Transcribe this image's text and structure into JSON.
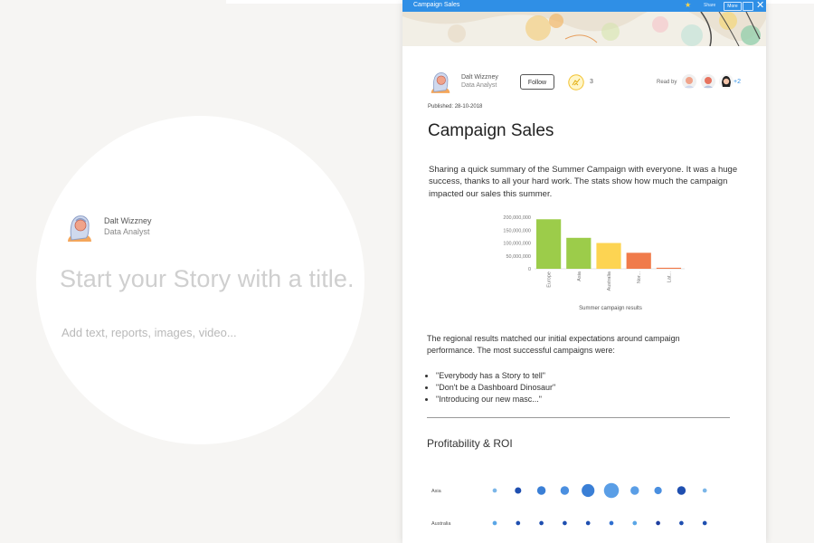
{
  "editor": {
    "author_name": "Dalt Wizzney",
    "author_role": "Data Analyst",
    "title_placeholder": "Start your Story with a title.",
    "body_placeholder": "Add text, reports, images, video..."
  },
  "story": {
    "window_title": "Campaign Sales",
    "toolbar": {
      "share_label": "Share",
      "more_label": "More"
    },
    "author_name": "Dalt Wizzney",
    "author_role": "Data Analyst",
    "follow_label": "Follow",
    "like_count": "3",
    "read_by_label": "Read by",
    "read_by_more": "+2",
    "published_label": "Published:",
    "published_date": "28-10-2018",
    "title": "Campaign Sales",
    "intro": "Sharing a quick summary of the Summer Campaign with everyone. It was a huge success, thanks to all your hard work. The stats show how much the campaign impacted our sales this summer.",
    "paragraph2": "The regional results matched our initial expectations around campaign performance. The most successful campaigns were:",
    "campaigns": [
      "\"Everybody has a Story to tell\"",
      "\"Don't be a Dashboard Dinosaur\"",
      "\"Introducing our new masc...\""
    ],
    "section_title": "Profitability & ROI"
  },
  "colors": {
    "titlebar": "#2f8fe6",
    "bar_europe": "#9ccc4a",
    "bar_asia": "#9ccc4a",
    "bar_australia": "#fdd452",
    "bar_north": "#f07b4b",
    "bar_latin": "#f07b4b",
    "bubble": "#2f7fdc"
  },
  "chart_data": [
    {
      "type": "bar",
      "title": "",
      "xlabel": "Summer campaign results",
      "ylabel": "",
      "categories": [
        "Europe",
        "Asia",
        "Australia",
        "Nor...",
        "Lat..."
      ],
      "values": [
        192000000,
        120000000,
        100000000,
        62000000,
        4000000
      ],
      "ylim": [
        0,
        200000000
      ],
      "yticks": [
        "0",
        "50,000,000",
        "100,000,000",
        "150,000,000",
        "200,000,000"
      ],
      "ytick_values": [
        0,
        50000000,
        100000000,
        150000000,
        200000000
      ],
      "grid": false
    },
    {
      "type": "scatter",
      "title": "Profitability & ROI",
      "rows": [
        {
          "name": "Asia",
          "sizes": [
            2,
            3,
            4,
            4,
            6,
            7,
            4,
            3.5,
            4,
            2
          ]
        },
        {
          "name": "Australia",
          "sizes": [
            2,
            2,
            2,
            2,
            2,
            2,
            2,
            2,
            2,
            2
          ]
        }
      ],
      "row_colors": [
        [
          "#7bb6e8",
          "#1f4fb0",
          "#3a7fd6",
          "#4a8fe0",
          "#3a7fd6",
          "#5a9ee6",
          "#5a9ee6",
          "#4a8fe0",
          "#1f4fb0",
          "#7bb6e8"
        ],
        [
          "#5aa6e6",
          "#1f4fb0",
          "#1f4fb0",
          "#1f4fb0",
          "#1f4fb0",
          "#2f6fcf",
          "#5aa6e6",
          "#1f3fa0",
          "#1f4fb0",
          "#1f4fb0"
        ]
      ]
    }
  ]
}
